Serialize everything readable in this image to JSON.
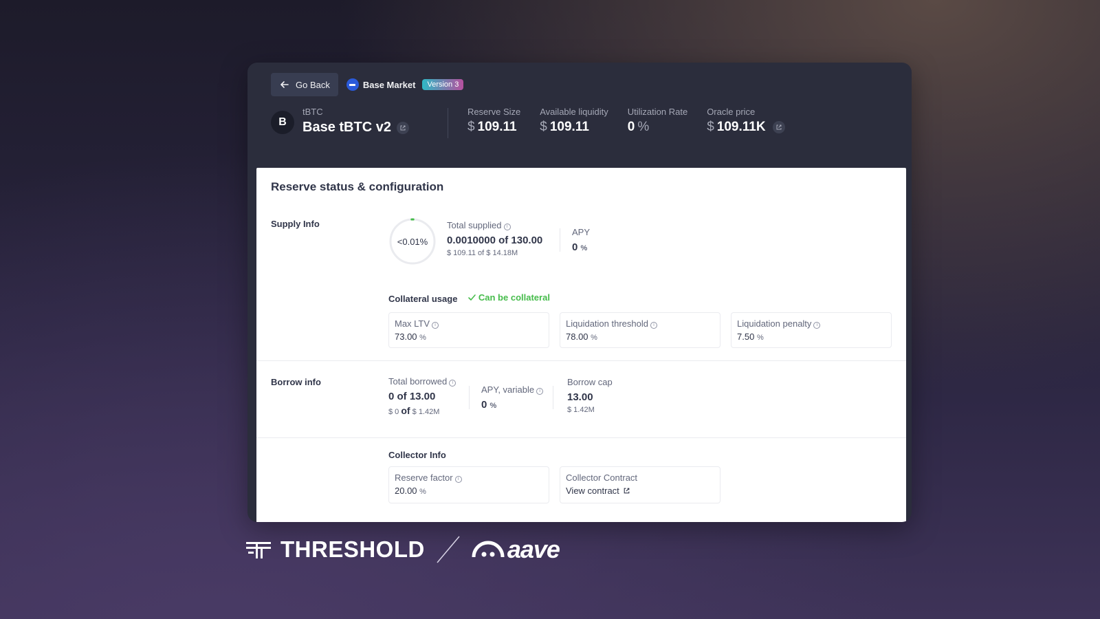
{
  "header": {
    "back_label": "Go Back",
    "market_name": "Base Market",
    "version_badge": "Version 3"
  },
  "asset": {
    "symbol": "tBTC",
    "name": "Base tBTC v2",
    "logo_glyph": "B"
  },
  "stats": [
    {
      "label": "Reserve Size",
      "prefix": "$",
      "value": "109.11",
      "suffix": ""
    },
    {
      "label": "Available liquidity",
      "prefix": "$",
      "value": "109.11",
      "suffix": ""
    },
    {
      "label": "Utilization Rate",
      "prefix": "",
      "value": "0",
      "suffix": "%"
    },
    {
      "label": "Oracle price",
      "prefix": "$",
      "value": "109.11K",
      "suffix": ""
    }
  ],
  "panel": {
    "title": "Reserve status & configuration"
  },
  "supply": {
    "section_label": "Supply Info",
    "ring_text": "<0.01%",
    "ring_fraction": 0.0001,
    "total_supplied_label": "Total supplied",
    "total_supplied_value": "0.0010000 of 130.00",
    "total_supplied_usd": "$ 109.11 of $ 14.18M",
    "apy_label": "APY",
    "apy_value": "0",
    "apy_unit": "%"
  },
  "collateral": {
    "label": "Collateral usage",
    "status": "Can be collateral",
    "cards": [
      {
        "label": "Max LTV",
        "value": "73.00",
        "unit": "%"
      },
      {
        "label": "Liquidation threshold",
        "value": "78.00",
        "unit": "%"
      },
      {
        "label": "Liquidation penalty",
        "value": "7.50",
        "unit": "%"
      }
    ]
  },
  "borrow": {
    "section_label": "Borrow info",
    "total_borrowed_label": "Total borrowed",
    "total_borrowed_value": "0 of 13.00",
    "total_borrowed_usd_a": "$ 0",
    "total_borrowed_of": "of",
    "total_borrowed_usd_b": "$ 1.42M",
    "apy_label": "APY, variable",
    "apy_value": "0",
    "apy_unit": "%",
    "cap_label": "Borrow cap",
    "cap_value": "13.00",
    "cap_usd": "$ 1.42M"
  },
  "collector": {
    "label": "Collector Info",
    "reserve_factor_label": "Reserve factor",
    "reserve_factor_value": "20.00",
    "reserve_factor_unit": "%",
    "contract_label": "Collector Contract",
    "contract_link": "View contract"
  },
  "footer": {
    "threshold_text": "THRESHOLD",
    "aave_text": "aave"
  },
  "colors": {
    "accent_green": "#46bc4b",
    "badge_from": "#2eb9c5",
    "badge_to": "#b6509e",
    "dark_panel": "#2b2d3c"
  }
}
